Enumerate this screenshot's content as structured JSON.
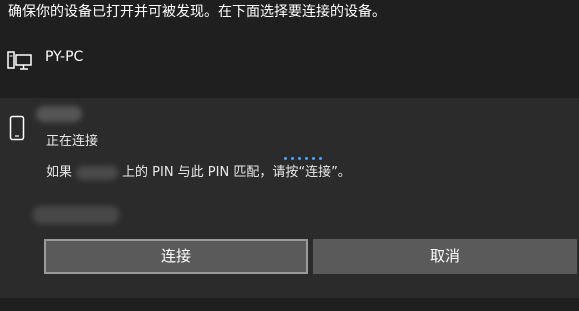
{
  "instruction": "确保你的设备已打开并可被发现。在下面选择要连接的设备。",
  "devices": [
    {
      "name": "PY-PC",
      "icon": "desktop-pc-icon"
    }
  ],
  "pairing": {
    "icon": "phone-icon",
    "status": "正在连接",
    "pin_prefix": "如果",
    "pin_suffix": "上的 PIN 与此 PIN 匹配，请按“连接”。",
    "spinner_color": "#4aa3ff",
    "connect_label": "连接",
    "cancel_label": "取消"
  },
  "colors": {
    "background": "#1f1f1f",
    "panel": "#2b2b2b",
    "button": "#5a5a5a",
    "button_focus_border": "#9a9a9a"
  }
}
